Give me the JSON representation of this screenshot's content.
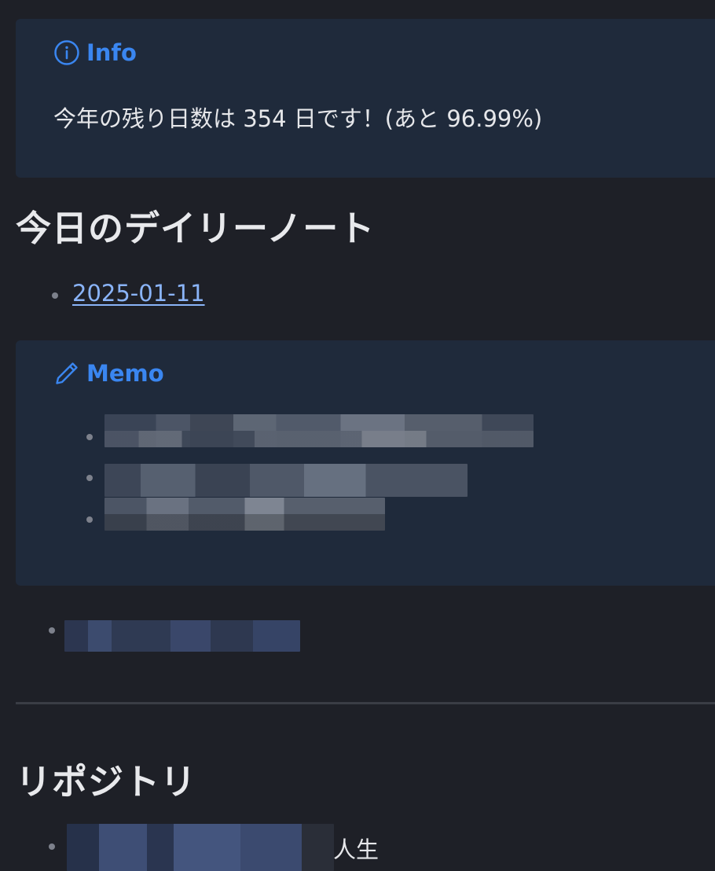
{
  "info_callout": {
    "title": "Info",
    "icon": "info-circle-icon",
    "text": "今年の残り日数は 354 日です！(あと 96.99%)"
  },
  "daily_section": {
    "heading": "今日のデイリーノート",
    "link": "2025-01-11"
  },
  "memo_callout": {
    "title": "Memo",
    "icon": "pencil-icon",
    "items": [
      "",
      "",
      ""
    ]
  },
  "repo_section": {
    "heading": "リポジトリ",
    "item_suffix": "人生"
  },
  "colors": {
    "accent": "#3a86f0",
    "link": "#8ab4f8",
    "callout_bg": "#1f2a3b",
    "page_bg": "#1e2027"
  }
}
